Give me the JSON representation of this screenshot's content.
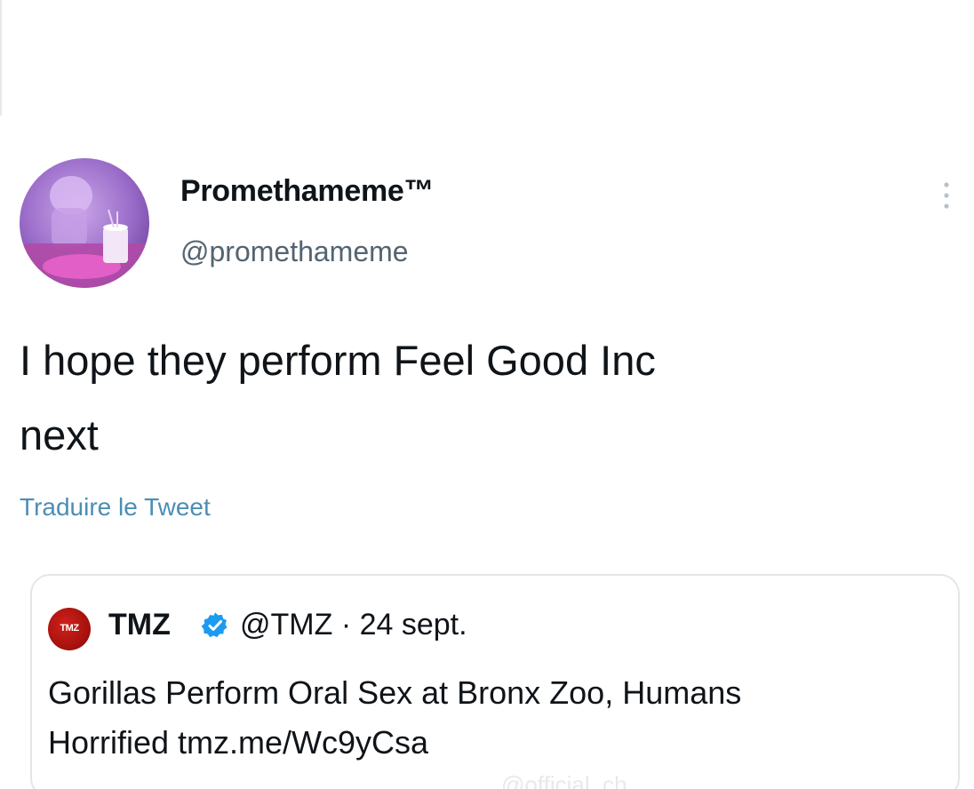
{
  "tweet": {
    "display_name": "Promethameme™",
    "handle": "@promethameme",
    "text": "I hope they perform Feel Good Inc\nnext",
    "translate_label": "Traduire le Tweet"
  },
  "quoted_tweet": {
    "display_name": "TMZ",
    "avatar_label": "TMZ",
    "meta": "@TMZ · 24 sept.",
    "text": "Gorillas Perform Oral Sex at Bronx Zoo, Humans\nHorrified tmz.me/Wc9yCsa",
    "verified": true
  },
  "watermark": "@official_ch",
  "icons": {
    "more": "more-vertical-icon",
    "verified": "verified-badge-icon"
  },
  "colors": {
    "text": "#0f1419",
    "secondary_text": "#536471",
    "link": "#4b8eb3",
    "verified": "#1d9bf0",
    "border": "#e3e6e8"
  }
}
